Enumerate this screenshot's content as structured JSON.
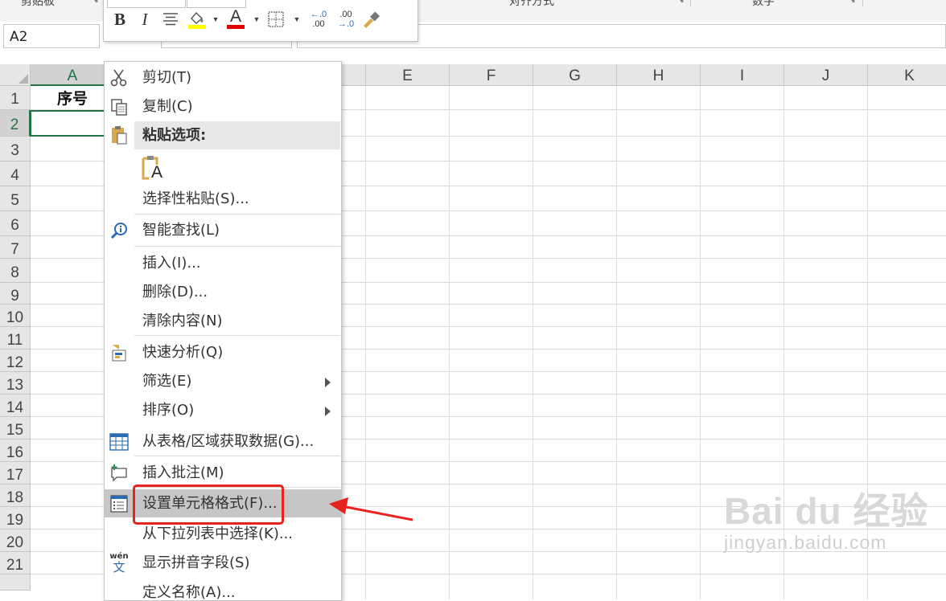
{
  "ribbon": {
    "groups": [
      "剪贴板",
      "对齐方式",
      "数字"
    ]
  },
  "name_box": "A2",
  "mini_toolbar": {
    "bold": "B",
    "italic": "I",
    "font_color_letter": "A",
    "decrease_decimal_top": "←.0",
    "decrease_decimal_bottom": ".00",
    "increase_decimal_top": ".00",
    "increase_decimal_bottom": "→.0",
    "fill_color": "#ffff00",
    "font_color": "#e00000"
  },
  "columns": [
    "A",
    "E",
    "F",
    "G",
    "H",
    "I",
    "J",
    "K"
  ],
  "selected_column": "A",
  "rows": [
    "1",
    "2",
    "3",
    "4",
    "5",
    "6",
    "7",
    "8",
    "9",
    "10",
    "11",
    "12",
    "13",
    "14",
    "15",
    "16",
    "17",
    "18",
    "19",
    "20",
    "21"
  ],
  "selected_row": "2",
  "cells": {
    "A1": "序号"
  },
  "context_menu": {
    "cut": "剪切(T)",
    "copy": "复制(C)",
    "paste_options_header": "粘贴选项:",
    "paste_icon_letter": "A",
    "paste_special": "选择性粘贴(S)...",
    "smart_lookup": "智能查找(L)",
    "insert": "插入(I)...",
    "delete": "删除(D)...",
    "clear_contents": "清除内容(N)",
    "quick_analysis": "快速分析(Q)",
    "filter": "筛选(E)",
    "sort": "排序(O)",
    "get_data": "从表格/区域获取数据(G)...",
    "insert_comment": "插入批注(M)",
    "format_cells": "设置单元格格式(F)...",
    "pick_from_list": "从下拉列表中选择(K)...",
    "phonetic": "显示拼音字段(S)",
    "phonetic_icon_top": "wén",
    "phonetic_icon_bottom": "文",
    "define_name": "定义名称(A)..."
  },
  "annotation": {
    "highlight_color": "#e8231d"
  },
  "watermark": {
    "brand": "Bai du 经验",
    "site": "jingyan.baidu.com"
  }
}
